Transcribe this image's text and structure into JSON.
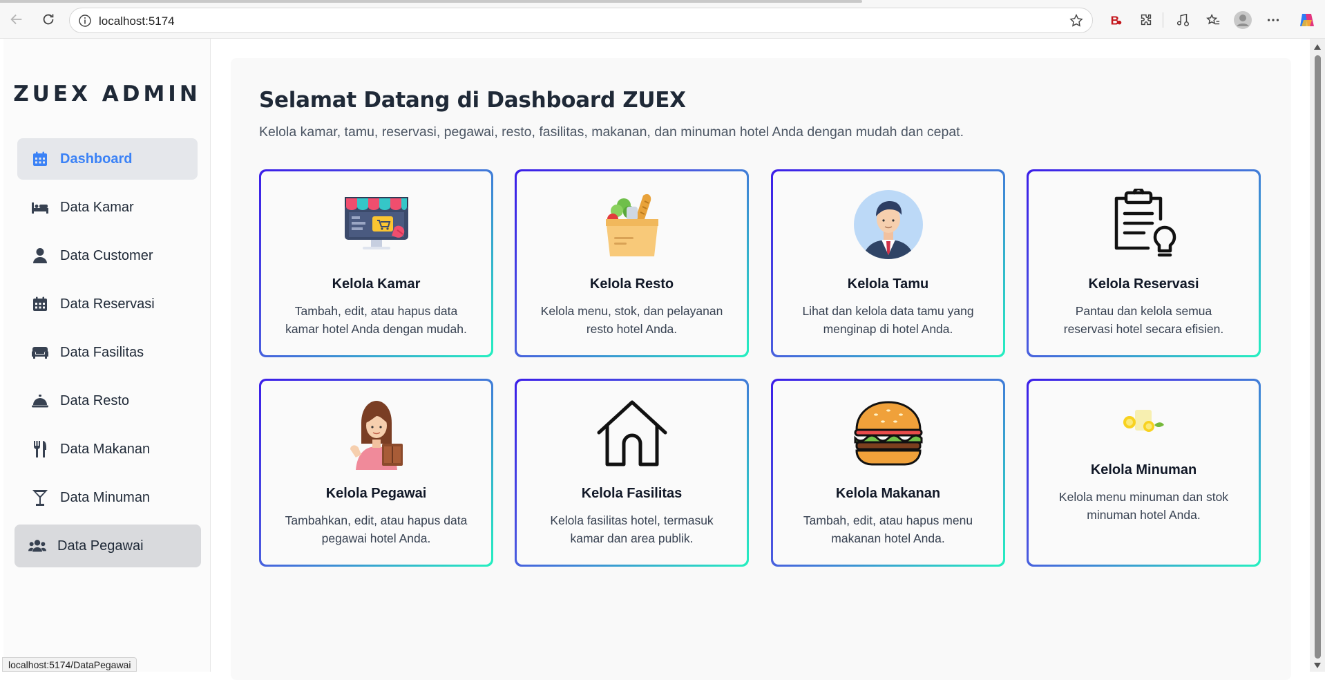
{
  "browser": {
    "url": "localhost:5174",
    "status_url": "localhost:5174/DataPegawai"
  },
  "sidebar": {
    "brand": "ZUEX ADMIN",
    "items": [
      {
        "label": "Dashboard",
        "icon": "calendar-icon",
        "state": "active"
      },
      {
        "label": "Data Kamar",
        "icon": "bed-icon"
      },
      {
        "label": "Data Customer",
        "icon": "user-icon"
      },
      {
        "label": "Data Reservasi",
        "icon": "calendar-icon"
      },
      {
        "label": "Data Fasilitas",
        "icon": "couch-icon"
      },
      {
        "label": "Data Resto",
        "icon": "cloche-icon"
      },
      {
        "label": "Data Makanan",
        "icon": "utensils-icon"
      },
      {
        "label": "Data Minuman",
        "icon": "cocktail-icon"
      },
      {
        "label": "Data Pegawai",
        "icon": "users-icon",
        "state": "hover"
      }
    ]
  },
  "main": {
    "title": "Selamat Datang di Dashboard ZUEX",
    "subtitle": "Kelola kamar, tamu, reservasi, pegawai, resto, fasilitas, makanan, dan minuman hotel Anda dengan mudah dan cepat.",
    "cards": [
      {
        "title": "Kelola Kamar",
        "desc": "Tambah, edit, atau hapus data kamar hotel Anda dengan mudah.",
        "icon": "online-store-icon"
      },
      {
        "title": "Kelola Resto",
        "desc": "Kelola menu, stok, dan pelayanan resto hotel Anda.",
        "icon": "grocery-bag-icon"
      },
      {
        "title": "Kelola Tamu",
        "desc": "Lihat dan kelola data tamu yang menginap di hotel Anda.",
        "icon": "guest-avatar-icon"
      },
      {
        "title": "Kelola Reservasi",
        "desc": "Pantau dan kelola semua reservasi hotel secara efisien.",
        "icon": "clipboard-idea-icon"
      },
      {
        "title": "Kelola Pegawai",
        "desc": "Tambahkan, edit, atau hapus data pegawai hotel Anda.",
        "icon": "staff-woman-icon"
      },
      {
        "title": "Kelola Fasilitas",
        "desc": "Kelola fasilitas hotel, termasuk kamar dan area publik.",
        "icon": "house-icon"
      },
      {
        "title": "Kelola Makanan",
        "desc": "Tambah, edit, atau hapus menu makanan hotel Anda.",
        "icon": "burger-icon"
      },
      {
        "title": "Kelola Minuman",
        "desc": "Kelola menu minuman dan stok minuman hotel Anda.",
        "icon": "lemon-drink-icon"
      }
    ]
  },
  "colors": {
    "accent": "#3b82f6",
    "card_border_start": "#3b1ee8",
    "card_border_end": "#25f0c0"
  }
}
